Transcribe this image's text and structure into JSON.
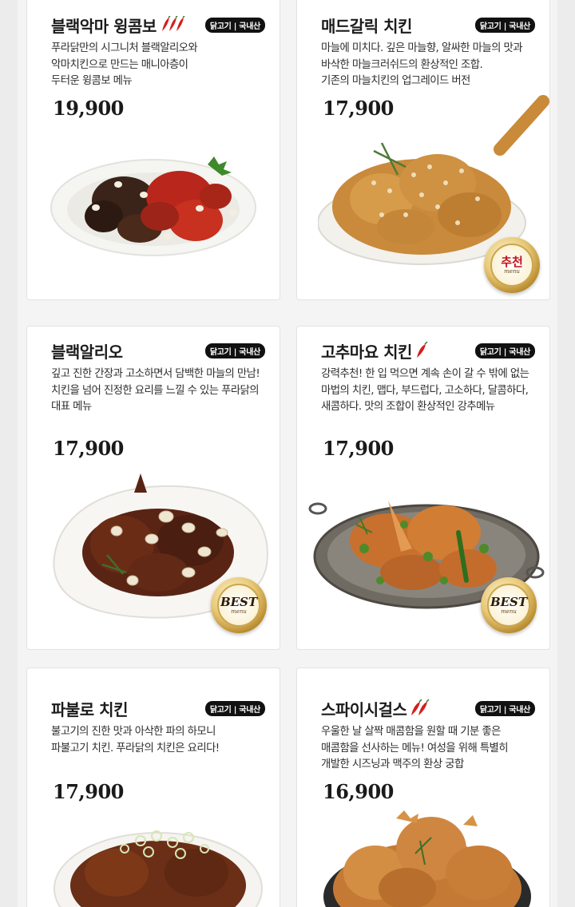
{
  "badge_label": "닭고기 | 국내산",
  "menus": [
    {
      "title": "블랙악마 윙콤보",
      "desc": [
        "푸라닭만의 시그니처 블랙알리오와",
        "악마치킨으로 만드는 매니아층이",
        "두터운 윙콤보 메뉴"
      ],
      "price": "19,900"
    },
    {
      "title": "매드갈릭 치킨",
      "desc": [
        "마늘에 미치다. 깊은 마늘향, 알싸한 마늘의 맛과",
        "바삭한 마늘크러쉬드의 환상적인 조합.",
        "기존의 마늘치킨의 업그레이드 버전"
      ],
      "price": "17,900",
      "medal": "추천",
      "medal_sub": "menu"
    },
    {
      "title": "블랙알리오",
      "desc": [
        "깊고 진한 간장과 고소하면서 담백한 마늘의 만남!",
        "치킨을 넘어 진정한 요리를 느낄 수 있는 푸라닭의",
        "대표 메뉴"
      ],
      "price": "17,900",
      "medal": "BEST",
      "medal_sub": "menu"
    },
    {
      "title": "고추마요 치킨",
      "desc": [
        "강력추천! 한 입 먹으면 계속 손이 갈 수 밖에 없는",
        "마법의 치킨, 맵다, 부드럽다, 고소하다, 달콤하다,",
        "새콤하다. 맛의 조합이 환상적인 강추메뉴"
      ],
      "price": "17,900",
      "medal": "BEST",
      "medal_sub": "menu"
    },
    {
      "title": "파불로 치킨",
      "desc": [
        "불고기의 진한 맛과 아삭한 파의 하모니",
        "파불고기 치킨. 푸라닭의 치킨은 요리다!"
      ],
      "price": "17,900"
    },
    {
      "title": "스파이시걸스",
      "desc": [
        "우울한 날 살짝 매콤함을 원할 때 기분 좋은",
        "매콤함을 선사하는 메뉴! 여성을 위해 특별히",
        "개발한 시즈닝과 맥주의 환상 궁합"
      ],
      "price": "16,900"
    }
  ]
}
